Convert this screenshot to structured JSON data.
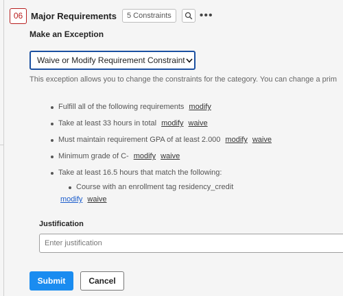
{
  "header": {
    "number": "06",
    "title": "Major Requirements",
    "constraints_badge": "5 Constraints",
    "search_icon": "search-icon",
    "more_icon": "ellipsis-icon",
    "more_label": "•••"
  },
  "exception": {
    "section_title": "Make an Exception",
    "select_value": "Waive or Modify Requirement Constraint",
    "description": "This exception allows you to change the constraints for the category. You can change a prim"
  },
  "constraints": [
    {
      "text": "Fulfill all of the following requirements",
      "links": [
        "modify"
      ]
    },
    {
      "text": "Take at least 33 hours in total",
      "links": [
        "modify",
        "waive"
      ]
    },
    {
      "text": "Must maintain requirement GPA of at least 2.000",
      "links": [
        "modify",
        "waive"
      ]
    },
    {
      "text": "Minimum grade of C-",
      "links": [
        "modify",
        "waive"
      ]
    },
    {
      "text": "Take at least 16.5 hours that match the following:",
      "links": []
    }
  ],
  "sub_constraint": {
    "text": "Course with an enrollment tag residency_credit",
    "links": [
      "modify",
      "waive"
    ]
  },
  "justification": {
    "label": "Justification",
    "placeholder": "Enter justification",
    "value": ""
  },
  "actions": {
    "submit_label": "Submit",
    "cancel_label": "Cancel"
  },
  "colors": {
    "accent": "#1a8cf0",
    "select_border": "#1a4fa0",
    "number_badge": "#b71c1c",
    "link_blue": "#1a5ccc"
  }
}
